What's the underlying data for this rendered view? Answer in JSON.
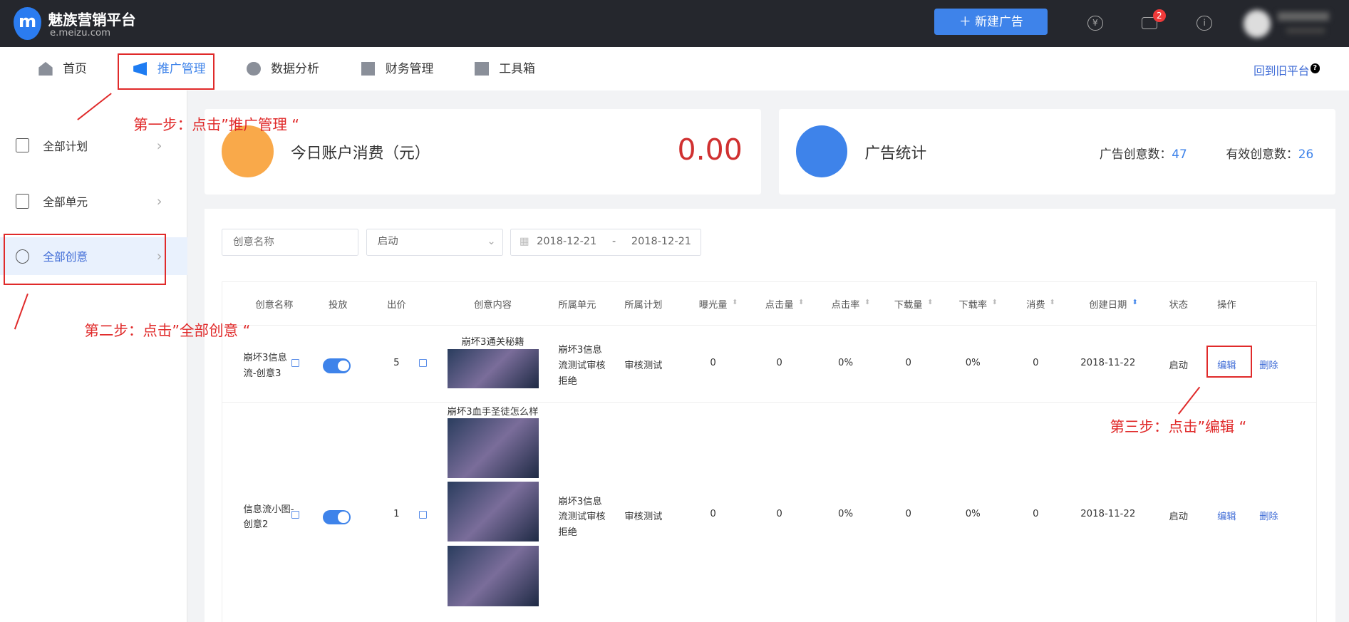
{
  "header": {
    "logo_letter": "m",
    "brand": "魅族营销平台",
    "domain": "e.meizu.com",
    "new_ad": "新建广告",
    "mail_badge": "2"
  },
  "nav": {
    "items": [
      {
        "label": "首页"
      },
      {
        "label": "推广管理",
        "active": true
      },
      {
        "label": "数据分析"
      },
      {
        "label": "财务管理"
      },
      {
        "label": "工具箱"
      }
    ],
    "old_platform": "回到旧平台"
  },
  "sidebar": {
    "items": [
      {
        "label": "全部计划"
      },
      {
        "label": "全部单元"
      },
      {
        "label": "全部创意",
        "active": true
      }
    ]
  },
  "cards": {
    "spend_title": "今日账户消费（元）",
    "spend_value": "0.00",
    "stats_title": "广告统计",
    "creative_count_label": "广告创意数：",
    "creative_count": "47",
    "valid_count_label": "有效创意数：",
    "valid_count": "26"
  },
  "filters": {
    "name_placeholder": "创意名称",
    "status": "启动",
    "date_start": "2018-12-21",
    "date_sep": "-",
    "date_end": "2018-12-21"
  },
  "table": {
    "headers": [
      "创意名称",
      "投放",
      "出价",
      "创意内容",
      "所属单元",
      "所属计划",
      "曝光量",
      "点击量",
      "点击率",
      "下载量",
      "下载率",
      "消费",
      "创建日期",
      "状态",
      "操作"
    ],
    "rows": [
      {
        "name1": "崩坏3信息",
        "name2": "流-创意3",
        "bid": "5",
        "content_title": "崩坏3通关秘籍",
        "unit1": "崩坏3信息",
        "unit2": "流测试审核",
        "unit3": "拒绝",
        "plan": "审核测试",
        "impressions": "0",
        "clicks": "0",
        "ctr": "0%",
        "downloads": "0",
        "dl_rate": "0%",
        "cost": "0",
        "date": "2018-11-22",
        "status": "启动",
        "edit": "编辑",
        "delete": "删除"
      },
      {
        "name1": "信息流小图-",
        "name2": "创意2",
        "bid": "1",
        "content_title": "崩坏3血手圣徒怎么样",
        "unit1": "崩坏3信息",
        "unit2": "流测试审核",
        "unit3": "拒绝",
        "plan": "审核测试",
        "impressions": "0",
        "clicks": "0",
        "ctr": "0%",
        "downloads": "0",
        "dl_rate": "0%",
        "cost": "0",
        "date": "2018-11-22",
        "status": "启动",
        "edit": "编辑",
        "delete": "删除"
      }
    ]
  },
  "annotations": {
    "step1": "第一步：点击”推广管理 “",
    "step2": "第二步：点击”全部创意 “",
    "step3": "第三步：点击”编辑 “"
  },
  "colors": {
    "accent": "#3e83ea",
    "annotation": "#e02a2a",
    "spend": "#d03030"
  }
}
